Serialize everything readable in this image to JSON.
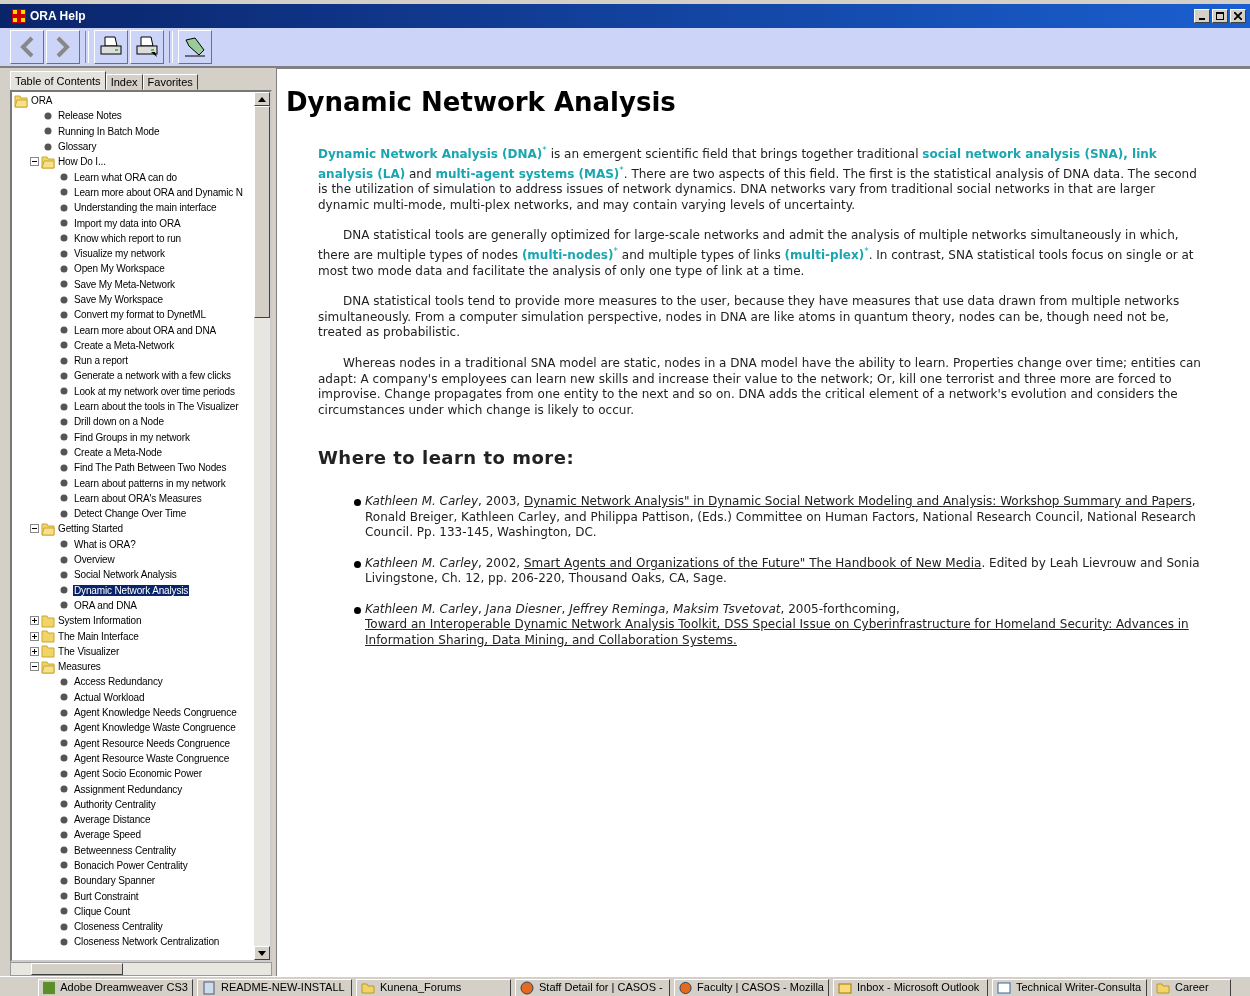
{
  "window": {
    "title": "ORA Help"
  },
  "toolbar": [
    {
      "kind": "back"
    },
    {
      "kind": "forward"
    },
    {
      "kind": "print"
    },
    {
      "kind": "print-setup"
    },
    {
      "kind": "options"
    }
  ],
  "tabs": [
    {
      "label": "Table of Contents",
      "selected": true
    },
    {
      "label": "Index",
      "selected": false
    },
    {
      "label": "Favorites",
      "selected": false
    }
  ],
  "tree": [
    {
      "label": "ORA",
      "kind": "folder",
      "expanded": true,
      "selected": false,
      "children": [
        {
          "label": "Release Notes",
          "kind": "topic",
          "selected": false
        },
        {
          "label": "Running In Batch Mode",
          "kind": "topic",
          "selected": false
        },
        {
          "label": "Glossary",
          "kind": "topic",
          "selected": false
        },
        {
          "label": "How Do I...",
          "kind": "folder",
          "expanded": true,
          "selected": false,
          "children": [
            {
              "label": "Learn what ORA can do",
              "kind": "topic",
              "selected": false
            },
            {
              "label": "Learn more about ORA and Dynamic N",
              "kind": "topic",
              "selected": false
            },
            {
              "label": "Understanding the main interface",
              "kind": "topic",
              "selected": false
            },
            {
              "label": "Import my data into ORA",
              "kind": "topic",
              "selected": false
            },
            {
              "label": "Know which report to run",
              "kind": "topic",
              "selected": false
            },
            {
              "label": "Visualize my network",
              "kind": "topic",
              "selected": false
            },
            {
              "label": "Open My Workspace",
              "kind": "topic",
              "selected": false
            },
            {
              "label": "Save My Meta-Network",
              "kind": "topic",
              "selected": false
            },
            {
              "label": "Save My Workspace",
              "kind": "topic",
              "selected": false
            },
            {
              "label": "Convert my format to DynetML",
              "kind": "topic",
              "selected": false
            },
            {
              "label": "Learn more about ORA and DNA",
              "kind": "topic",
              "selected": false
            },
            {
              "label": "Create a Meta-Network",
              "kind": "topic",
              "selected": false
            },
            {
              "label": "Run a report",
              "kind": "topic",
              "selected": false
            },
            {
              "label": "Generate a network with a few clicks",
              "kind": "topic",
              "selected": false
            },
            {
              "label": "Look at my network over time periods",
              "kind": "topic",
              "selected": false
            },
            {
              "label": "Learn about the tools in The Visualizer",
              "kind": "topic",
              "selected": false
            },
            {
              "label": "Drill down on a Node",
              "kind": "topic",
              "selected": false
            },
            {
              "label": "Find Groups in my network",
              "kind": "topic",
              "selected": false
            },
            {
              "label": "Create a Meta-Node",
              "kind": "topic",
              "selected": false
            },
            {
              "label": "Find The Path Between Two Nodes",
              "kind": "topic",
              "selected": false
            },
            {
              "label": "Learn about patterns in my network",
              "kind": "topic",
              "selected": false
            },
            {
              "label": "Learn about ORA's Measures",
              "kind": "topic",
              "selected": false
            },
            {
              "label": "Detect Change Over Time",
              "kind": "topic",
              "selected": false
            }
          ]
        },
        {
          "label": "Getting Started",
          "kind": "folder",
          "expanded": true,
          "selected": false,
          "children": [
            {
              "label": "What is ORA?",
              "kind": "topic",
              "selected": false
            },
            {
              "label": "Overview",
              "kind": "topic",
              "selected": false
            },
            {
              "label": "Social Network Analysis",
              "kind": "topic",
              "selected": false
            },
            {
              "label": "Dynamic Network Analysis",
              "kind": "topic",
              "selected": true
            },
            {
              "label": "ORA and DNA",
              "kind": "topic",
              "selected": false
            }
          ]
        },
        {
          "label": "System Information",
          "kind": "folder",
          "expanded": false,
          "selected": false
        },
        {
          "label": "The Main Interface",
          "kind": "folder",
          "expanded": false,
          "selected": false
        },
        {
          "label": "The Visualizer",
          "kind": "folder",
          "expanded": false,
          "selected": false
        },
        {
          "label": "Measures",
          "kind": "folder",
          "expanded": true,
          "selected": false,
          "children": [
            {
              "label": "Access Redundancy",
              "kind": "topic",
              "selected": false
            },
            {
              "label": "Actual Workload",
              "kind": "topic",
              "selected": false
            },
            {
              "label": "Agent Knowledge Needs Congruence",
              "kind": "topic",
              "selected": false
            },
            {
              "label": "Agent Knowledge Waste Congruence",
              "kind": "topic",
              "selected": false
            },
            {
              "label": "Agent Resource Needs Congruence",
              "kind": "topic",
              "selected": false
            },
            {
              "label": "Agent Resource Waste Congruence",
              "kind": "topic",
              "selected": false
            },
            {
              "label": "Agent Socio Economic Power",
              "kind": "topic",
              "selected": false
            },
            {
              "label": "Assignment Redundancy",
              "kind": "topic",
              "selected": false
            },
            {
              "label": "Authority Centrality",
              "kind": "topic",
              "selected": false
            },
            {
              "label": "Average Distance",
              "kind": "topic",
              "selected": false
            },
            {
              "label": "Average Speed",
              "kind": "topic",
              "selected": false
            },
            {
              "label": "Betweenness Centrality",
              "kind": "topic",
              "selected": false
            },
            {
              "label": "Bonacich Power Centrality",
              "kind": "topic",
              "selected": false
            },
            {
              "label": "Boundary Spanner",
              "kind": "topic",
              "selected": false
            },
            {
              "label": "Burt Constraint",
              "kind": "topic",
              "selected": false
            },
            {
              "label": "Clique Count",
              "kind": "topic",
              "selected": false
            },
            {
              "label": "Closeness Centrality",
              "kind": "topic",
              "selected": false
            },
            {
              "label": "Closeness Network Centralization",
              "kind": "topic",
              "selected": false
            }
          ]
        }
      ]
    }
  ],
  "article": {
    "title": "Dynamic Network Analysis",
    "paragraphs": [
      "**Dynamic Network Analysis (DNA)**$^{*}$ is an emergent scientific field that brings together traditional **social network analysis (SNA), link analysis (LA)** and **multi-agent systems (MAS)**$^{*}$. There are two aspects of this field. The first is the statistical analysis of DNA data. The second is the utilization of simulation to address issues of network dynamics. DNA networks vary from traditional social networks in that are larger dynamic multi-mode, multi-plex networks, and may contain varying levels of uncertainty.",
      "DNA statistical tools are generally optimized for large-scale networks and admit the analysis of multiple networks simultaneously in which, there are multiple types of nodes **(multi-nodes)**$^{*}$ and multiple types of links **(multi-plex)**$^{*}$. In contrast, SNA statistical tools focus on single or at most two mode data and facilitate the analysis of only one type of link at a time.",
      "DNA statistical tools tend to provide more measures to the user, because they have measures that use data drawn from multiple networks simultaneously. From a computer simulation perspective, nodes in DNA are like atoms in quantum theory, nodes can be, though need not be, treated as probabilistic.",
      "Whereas nodes in a traditional SNA model are static, nodes in a DNA model have the ability to learn. Properties change over time; entities can adapt: A company's employees can learn new skills and increase their value to the network; Or, kill one terrorist and three more are forced to improvise. Change propagates from one entity to the next and so on. DNA adds the critical element of a network's evolution and considers the circumstances under which change is likely to occur."
    ],
    "section_heading": "Where to learn to more:",
    "references": [
      {
        "before": "*Kathleen M. Carley*, 2003, ",
        "link": "Dynamic Network Analysis\" in Dynamic Social Network Modeling and Analysis: Workshop Summary and Papers",
        "after": ", Ronald Breiger, Kathleen Carley, and Philippa Pattison, (Eds.) Committee on Human Factors, National Research Council, National Research Council. Pp. 133-145, Washington, DC."
      },
      {
        "before": "*Kathleen M. Carley*, 2002, ",
        "link": "Smart Agents and Organizations of the Future\" The Handbook of New Media",
        "after": ". Edited by Leah Lievrouw and Sonia Livingstone, Ch. 12, pp. 206-220, Thousand Oaks, CA, Sage."
      },
      {
        "before": "*Kathleen M. Carley*, *Jana Diesner*, *Jeffrey Reminga*, *Maksim Tsvetovat*, 2005-forthcoming, ",
        "link": "Toward an Interoperable Dynamic Network Analysis Toolkit, DSS Special Issue on Cyberinfrastructure for Homeland Security: Advances in Information Sharing, Data Mining, and Collaboration Systems."
      }
    ]
  },
  "taskbar": [
    {
      "label": "Adobe Dreamweaver CS3",
      "kind": "dw"
    },
    {
      "label": "README-NEW-INSTALL",
      "kind": "notepad"
    },
    {
      "label": "Kunena_Forums",
      "kind": "folder"
    },
    {
      "label": "Staff Detail for | CASOS -",
      "kind": "firefox"
    },
    {
      "label": "Faculty | CASOS - Mozilla",
      "kind": "firefox"
    },
    {
      "label": "Inbox - Microsoft Outlook",
      "kind": "outlook"
    },
    {
      "label": "Technical Writer-Consulta",
      "kind": "ie"
    },
    {
      "label": "Career",
      "kind": "folder"
    }
  ]
}
